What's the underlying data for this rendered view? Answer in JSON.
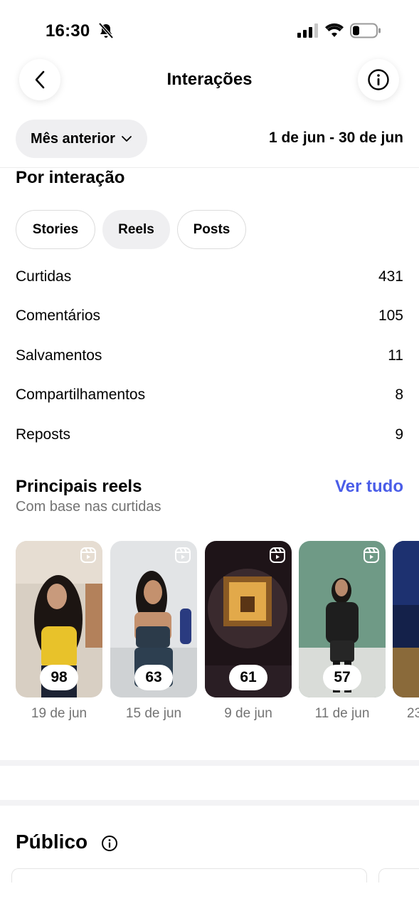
{
  "status_bar": {
    "time": "16:30"
  },
  "header": {
    "title": "Interações"
  },
  "period": {
    "selector_label": "Mês anterior",
    "range": "1 de jun - 30 de jun"
  },
  "by_interaction": {
    "title": "Por interação",
    "tabs": [
      {
        "label": "Stories",
        "active": false
      },
      {
        "label": "Reels",
        "active": true
      },
      {
        "label": "Posts",
        "active": false
      }
    ],
    "metrics": [
      {
        "label": "Curtidas",
        "value": "431"
      },
      {
        "label": "Comentários",
        "value": "105"
      },
      {
        "label": "Salvamentos",
        "value": "11"
      },
      {
        "label": "Compartilhamentos",
        "value": "8"
      },
      {
        "label": "Reposts",
        "value": "9"
      }
    ]
  },
  "top_reels": {
    "title": "Principais reels",
    "subtitle": "Com base nas curtidas",
    "see_all": "Ver tudo",
    "items": [
      {
        "count": "98",
        "date": "19 de jun"
      },
      {
        "count": "63",
        "date": "15 de jun"
      },
      {
        "count": "61",
        "date": "9 de jun"
      },
      {
        "count": "57",
        "date": "11 de jun"
      },
      {
        "count": "",
        "date": "23"
      }
    ]
  },
  "audience": {
    "title": "Público"
  },
  "colors": {
    "accent": "#4a5de8",
    "muted": "#737373",
    "pill_bg": "#efeff1"
  }
}
